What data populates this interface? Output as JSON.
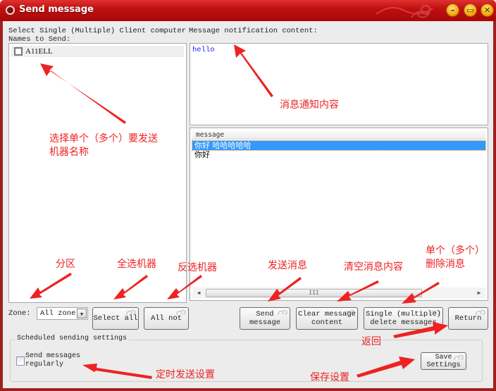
{
  "window": {
    "title": "Send message",
    "controls": {
      "minimize": "minimize",
      "maximize": "maximize",
      "close": "close"
    }
  },
  "left": {
    "label": "Select Single (Multiple) Client computer\nNames to Send:",
    "clients": [
      {
        "name": "A11ELL",
        "checked": false
      }
    ]
  },
  "right": {
    "label": "Message notification content:",
    "message_text": "hello",
    "table": {
      "header": "message",
      "rows": [
        {
          "text": "你好 哈哈哈哈哈",
          "selected": true
        },
        {
          "text": "你好",
          "selected": false
        }
      ],
      "scroll_thumb_grip": "III"
    }
  },
  "zone": {
    "label": "Zone:",
    "selected": "All zone"
  },
  "buttons": {
    "select_all": "Select all",
    "all_not": "All not",
    "send_message": "Send\nmessage",
    "clear_message": "Clear message\ncontent",
    "delete_messages": "Single (multiple)\ndelete messages",
    "return": "Return",
    "save_settings": "Save\nSettings"
  },
  "scheduled": {
    "legend": "Scheduled sending settings",
    "checkbox_label": "Send messages\nregularly",
    "checked": false
  },
  "annotations": {
    "client_list": "选择单个（多个）要发送\n机器名称",
    "message_content": "消息通知内容",
    "zone": "分区",
    "select_all": "全选机器",
    "invert": "反选机器",
    "send": "发送消息",
    "clear": "清空消息内容",
    "delete": "单个（多个）\n删除消息",
    "return": "返回",
    "scheduled": "定时发送设置",
    "save": "保存设置"
  },
  "colors": {
    "title_bar": "#c01010",
    "annotation": "#ee2222",
    "selection": "#3399ff",
    "message_text": "#1a1aff"
  }
}
